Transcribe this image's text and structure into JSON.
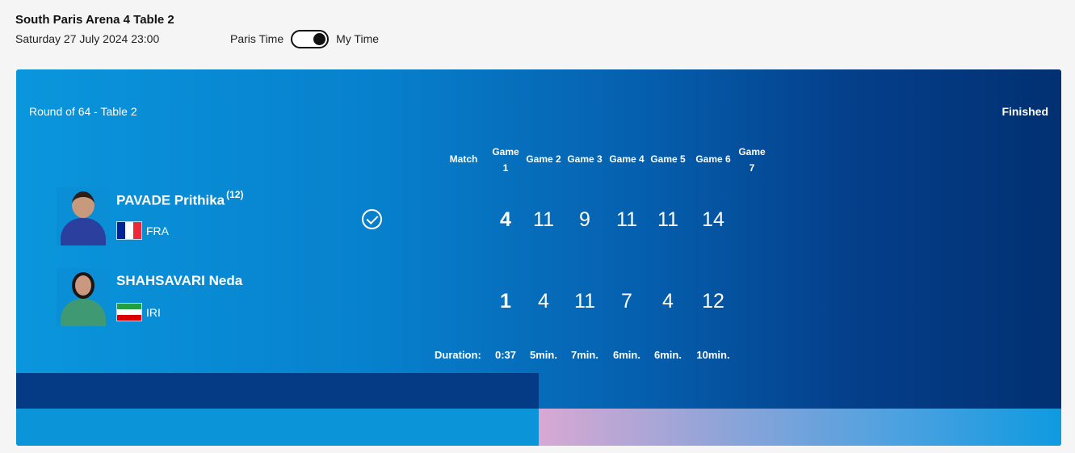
{
  "header": {
    "venue": "South Paris Arena 4 Table 2",
    "datetime": "Saturday 27 July 2024 23:00",
    "tz_left": "Paris Time",
    "tz_right": "My Time"
  },
  "match": {
    "round": "Round of 64 - Table 2",
    "status": "Finished",
    "columns": [
      "Match",
      "Game 1",
      "Game 2",
      "Game 3",
      "Game 4",
      "Game 5",
      "Game 6",
      "Game 7"
    ],
    "players": [
      {
        "name": "PAVADE Prithika",
        "seed": "(12)",
        "country": "FRA",
        "winner": true,
        "match_score": "4",
        "games": [
          "11",
          "9",
          "11",
          "11",
          "14"
        ]
      },
      {
        "name": "SHAHSAVARI Neda",
        "seed": "",
        "country": "IRI",
        "winner": false,
        "match_score": "1",
        "games": [
          "4",
          "11",
          "7",
          "4",
          "12"
        ]
      }
    ],
    "duration_label": "Duration:",
    "durations": [
      "0:37",
      "5min.",
      "7min.",
      "6min.",
      "6min.",
      "10min."
    ]
  },
  "colors": {
    "card_light": "#0a96dc",
    "card_dark": "#023072",
    "flag_fra": [
      "#002395",
      "#ffffff",
      "#ed2939"
    ],
    "flag_iri": [
      "#239f40",
      "#ffffff",
      "#da0000"
    ]
  }
}
